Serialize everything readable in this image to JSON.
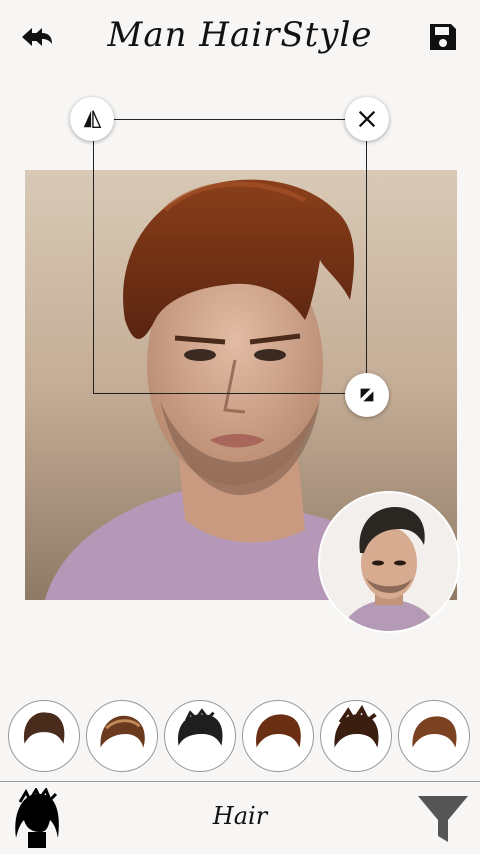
{
  "app": {
    "title": "Man HairStyle"
  },
  "toolbar": {
    "back_icon": "back-arrow-icon",
    "save_icon": "save-disk-icon"
  },
  "editor": {
    "flip_icon": "flip-icon",
    "close_icon": "close-icon",
    "scale_icon": "resize-rotate-icon"
  },
  "styles": {
    "count": 6,
    "colors": [
      "#4a2c1c",
      "#6b3a1e",
      "#1e1e1e",
      "#6a2e12",
      "#3a1e10",
      "#7a4220"
    ]
  },
  "bottom": {
    "label": "Hair",
    "left_icon": "hair-silhouette-icon",
    "right_icon": "filter-icon"
  }
}
